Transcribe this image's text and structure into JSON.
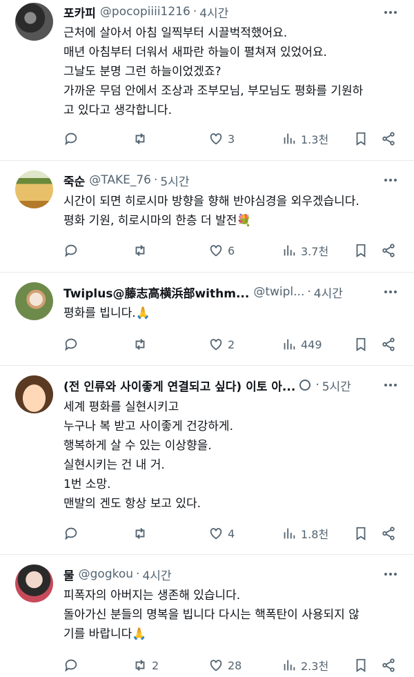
{
  "posts": [
    {
      "name": "포카피",
      "handle": "@pocopiiii1216",
      "time": "4시간",
      "lines": [
        "근처에 살아서 아침 일찍부터 시끌벅적했어요.",
        "매년 아침부터 더워서 새파란 하늘이 펼쳐져 있었어요.",
        "그날도 분명 그런 하늘이었겠죠?",
        "가까운 무덤 안에서 조상과 조부모님, 부모님도 평화를 기원하",
        "고 있다고 생각합니다."
      ],
      "replies": "",
      "retweets": "",
      "likes": "3",
      "views": "1.3천"
    },
    {
      "name": "죽순",
      "handle": "@TAKE_76",
      "time": "5시간",
      "lines": [
        "시간이 되면 히로시마 방향을 향해 반야심경을 외우겠습니다.",
        "평화 기원, 히로시마의 한층 더 발전💐"
      ],
      "replies": "",
      "retweets": "",
      "likes": "6",
      "views": "3.7천"
    },
    {
      "name": "Twiplus@藤志高横浜部withm...",
      "handle": "@twipl...",
      "time": "4시간",
      "lines": [
        "평화를 빕니다.🙏"
      ],
      "replies": "",
      "retweets": "",
      "likes": "2",
      "views": "449"
    },
    {
      "name": "(전 인류와 사이좋게 연결되고 싶다) 이토 아...",
      "handle": "",
      "time": "5시간",
      "lines": [
        "세계 평화를 실현시키고",
        "누구나 복 받고 사이좋게 건강하게.",
        "행복하게 살 수 있는 이상향을.",
        "실현시키는 건 내 거.",
        "1번 소망.",
        "맨발의 겐도 항상 보고 있다."
      ],
      "replies": "",
      "retweets": "",
      "likes": "4",
      "views": "1.8천"
    },
    {
      "name": "물",
      "handle": "@gogkou",
      "time": "4시간",
      "lines": [
        "피폭자의 아버지는 생존해 있습니다.",
        "돌아가신 분들의 명복을 빕니다 다시는 핵폭탄이 사용되지 않",
        "기를 바랍니다🙏"
      ],
      "replies": "",
      "retweets": "2",
      "likes": "28",
      "views": "2.3천"
    }
  ],
  "ui": {
    "dot": "·",
    "icons": {
      "reply": "reply-icon",
      "retweet": "retweet-icon",
      "like": "heart-icon",
      "views": "views-icon",
      "bookmark": "bookmark-icon",
      "share": "share-icon",
      "more": "more-icon"
    },
    "colors": {
      "text": "#0f1419",
      "secondary": "#536471",
      "divider": "#e6e9ec"
    }
  }
}
